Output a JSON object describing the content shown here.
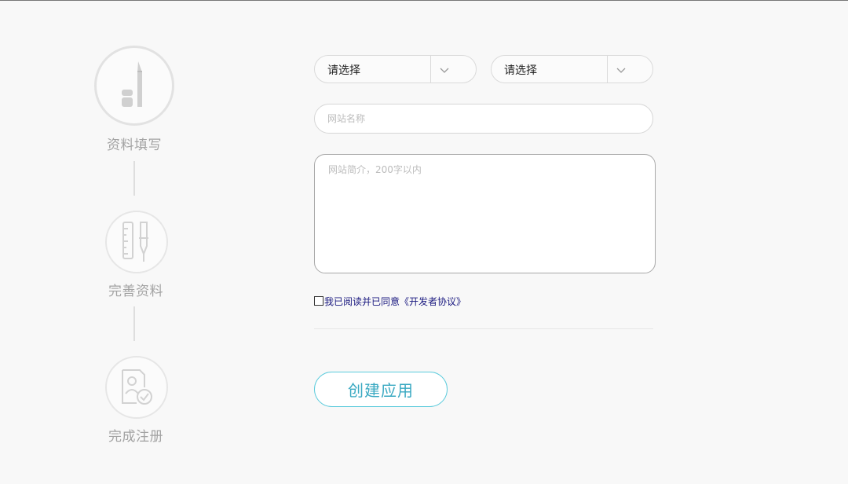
{
  "steps": [
    {
      "label": "资料填写",
      "icon": "pen-eraser-icon",
      "state": "active"
    },
    {
      "label": "完善资料",
      "icon": "ruler-pen-icon",
      "state": "pending"
    },
    {
      "label": "完成注册",
      "icon": "document-check-icon",
      "state": "pending"
    }
  ],
  "form": {
    "select_1": {
      "value": "请选择"
    },
    "select_2": {
      "value": "请选择"
    },
    "site_name": {
      "value": "",
      "placeholder": "网站名称"
    },
    "site_intro": {
      "value": "",
      "placeholder": "网站简介，200字以内"
    },
    "agreement": {
      "checked": false,
      "text": "我已阅读并已同意",
      "link": "《开发者协议》"
    },
    "submit_label": "创建应用"
  },
  "colors": {
    "accent": "#3aa9c2",
    "accent_border": "#5ccbdc",
    "link": "#1b1a80",
    "step_text": "#a2a2a2",
    "background": "#f8f8f8"
  }
}
